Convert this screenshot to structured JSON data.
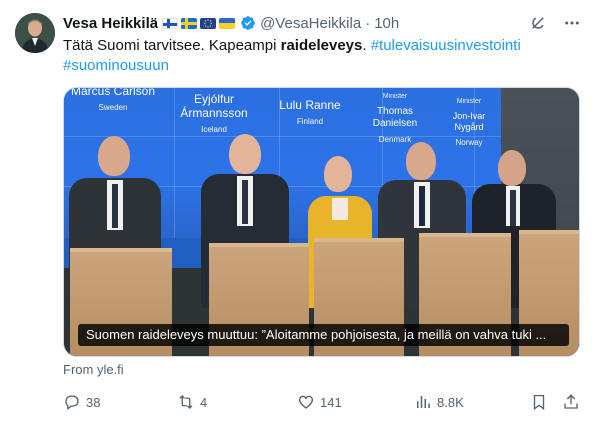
{
  "author": {
    "name": "Vesa Heikkilä",
    "handle": "@VesaHeikkila",
    "separator": "·",
    "time": "10h"
  },
  "tweet": {
    "text_plain_1": "Tätä Suomi tarvitsee. Kapeampi ",
    "text_bold": "raideleveys",
    "text_plain_2": ". ",
    "hashtag_1": "#tulevaisuusinvestointi",
    "hashtag_2": "#suominousuun"
  },
  "media": {
    "caption": "Suomen raideleveys muuttuu: ”Aloitamme pohjoisesta, ja meillä on vahva tuki ...",
    "nametags": [
      {
        "role": "",
        "name": "Marcus Carlson",
        "country": "Sweden"
      },
      {
        "role": "",
        "name": "Eyjólfur Ármannsson",
        "country": "Iceland"
      },
      {
        "role": "",
        "name": "Lulu Ranne",
        "country": "Finland"
      },
      {
        "role": "Minister",
        "name": "Thomas Danielsen",
        "country": "Denmark"
      },
      {
        "role": "Minister",
        "name": "Jon-Ivar Nygård",
        "country": "Norway"
      }
    ]
  },
  "source": "From yle.fi",
  "stats": {
    "replies": "38",
    "reposts": "4",
    "likes": "141",
    "views": "8.8K"
  },
  "colors": {
    "accent": "#1d9bf0",
    "muted": "#536471",
    "verified": "#1d9bf0"
  }
}
